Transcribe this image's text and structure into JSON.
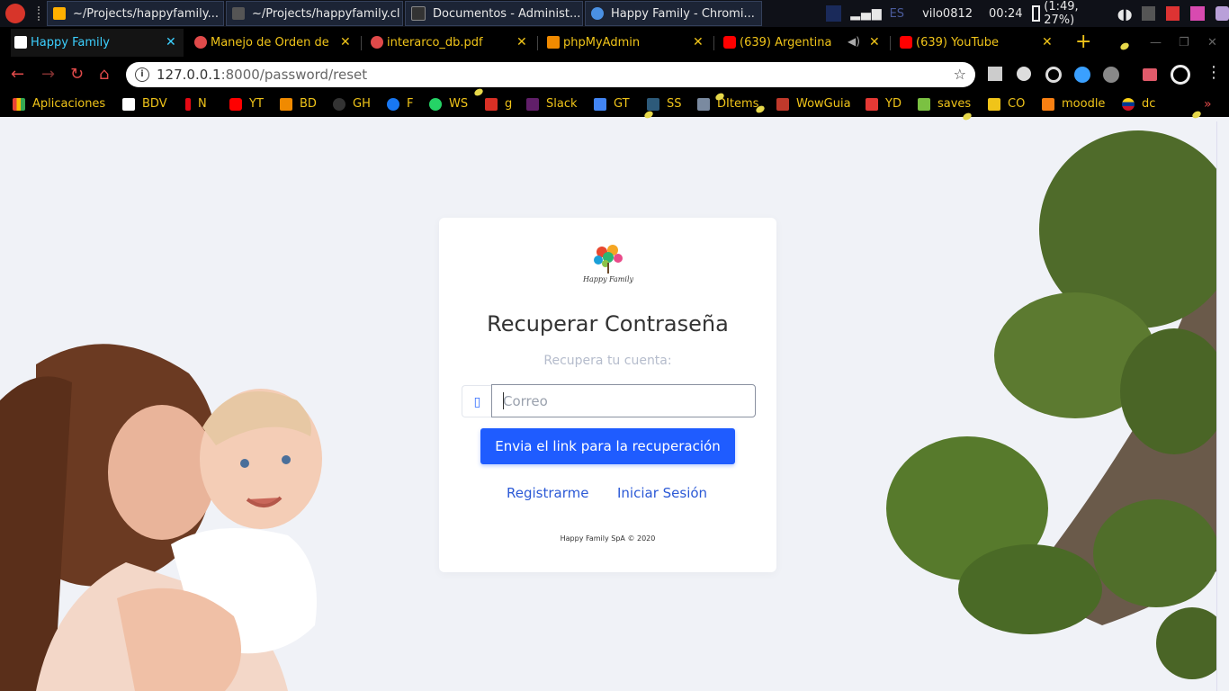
{
  "taskbar": {
    "tasks": [
      {
        "label": "~/Projects/happyfamily...",
        "color": "#ffb000"
      },
      {
        "label": "~/Projects/happyfamily.cl",
        "color": "#555555"
      },
      {
        "label": "Documentos - Administ...",
        "color": "#333333"
      },
      {
        "label": "Happy Family - Chromi...",
        "color": "#4a90e2"
      }
    ],
    "lang": "ES",
    "user": "vilo0812",
    "time": "00:24",
    "battery": "(1:49, 27%)"
  },
  "tabs": [
    {
      "label": "Happy Family",
      "active": true,
      "icon": "happy-family-favicon",
      "color": "#2a8a3a"
    },
    {
      "label": "Manejo de Orden de",
      "active": false,
      "icon": "globe-icon",
      "color": "#e04a4a"
    },
    {
      "label": "interarco_db.pdf",
      "active": false,
      "icon": "globe-icon",
      "color": "#e04a4a"
    },
    {
      "label": "phpMyAdmin",
      "active": false,
      "icon": "phpmyadmin-icon",
      "color": "#f08a00"
    },
    {
      "label": "(639) Argentina",
      "active": false,
      "icon": "youtube-icon",
      "color": "#ff0000"
    },
    {
      "label": "(639) YouTube",
      "active": false,
      "icon": "youtube-icon",
      "color": "#ff0000"
    }
  ],
  "omnibox": {
    "host": "127.0.0.1",
    "path": ":8000/password/reset"
  },
  "bookmarks": [
    {
      "label": "Aplicaciones",
      "color": "#4285f4"
    },
    {
      "label": "BDV",
      "color": "#e53935"
    },
    {
      "label": "N",
      "color": "#e50914"
    },
    {
      "label": "YT",
      "color": "#ff0000"
    },
    {
      "label": "BD",
      "color": "#f08a00"
    },
    {
      "label": "GH",
      "color": "#333333"
    },
    {
      "label": "F",
      "color": "#1877f2"
    },
    {
      "label": "WS",
      "color": "#25d366"
    },
    {
      "label": "g",
      "color": "#d93025"
    },
    {
      "label": "Slack",
      "color": "#611f69"
    },
    {
      "label": "GT",
      "color": "#4285f4"
    },
    {
      "label": "SS",
      "color": "#2d5a7a"
    },
    {
      "label": "DItems",
      "color": "#7a8aa0"
    },
    {
      "label": "WowGuia",
      "color": "#c0392b"
    },
    {
      "label": "YD",
      "color": "#e53935"
    },
    {
      "label": "saves",
      "color": "#f0c419"
    },
    {
      "label": "CO",
      "color": "#f0c419"
    },
    {
      "label": "moodle",
      "color": "#f98012"
    },
    {
      "label": "dc",
      "color": "#d32f2f"
    }
  ],
  "card": {
    "logo_text": "Happy Family",
    "title": "Recuperar Contraseña",
    "subtitle": "Recupera tu cuenta:",
    "email_placeholder": "Correo",
    "submit_label": "Envia el link para la recuperación",
    "register_label": "Registrarme",
    "login_label": "Iniciar Sesión",
    "footer": "Happy Family SpA © 2020"
  },
  "colors": {
    "accent": "#1f5cff",
    "link": "#2b59d6",
    "page_bg": "#f0f2f7"
  }
}
